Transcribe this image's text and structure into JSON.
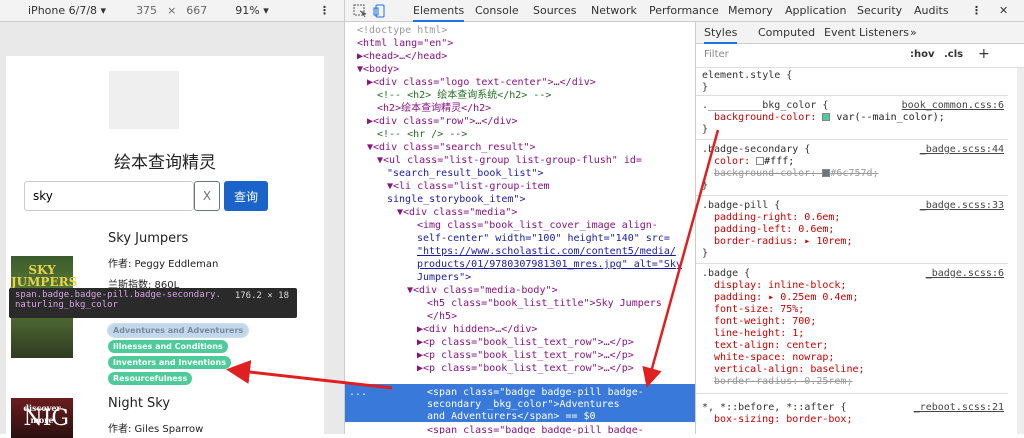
{
  "device_bar": {
    "device": "iPhone 6/7/8 ▾",
    "width": "375",
    "times": "×",
    "height": "667",
    "zoom": "91% ▾",
    "more": "⋮"
  },
  "page": {
    "title": "绘本查询精灵",
    "search_value": "sky",
    "clear_label": "X",
    "search_button": "查询",
    "books": [
      {
        "title": "Sky Jumpers",
        "author": "作者: Peggy Eddleman",
        "lexile": "兰斯指数: 860L",
        "cover_text": "SKY JUMPERS"
      },
      {
        "title": "Night Sky",
        "author": "作者: Giles Sparrow",
        "cover_text": "discover more",
        "cover_big": "NIG"
      }
    ],
    "badges": [
      "Adventures and Adventurers",
      "Illnesses and Conditions",
      "Inventors and Inventions",
      "Resourcefulness"
    ],
    "tooltip": {
      "selector": "span.badge.badge-pill.badge-secondary.",
      "selector2": "naturling_bkg_color",
      "dims": "176.2 × 18"
    }
  },
  "devtools": {
    "tabs": [
      "Elements",
      "Console",
      "Sources",
      "Network",
      "Performance",
      "Memory",
      "Application",
      "Security",
      "Audits"
    ],
    "active_tab": "Elements",
    "more": "⋮",
    "close": "✕",
    "elements": [
      "<!doctype html>",
      "<html lang=\"en\">",
      "▶<head>…</head>",
      "▼<body>",
      "▶<div class=\"logo text-center\">…</div>",
      "<!-- <h2>        绘本查询系统</h2> -->",
      "<h2>绘本查询精灵</h2>",
      "▶<div class=\"row\">…</div>",
      "<!-- <hr /> -->",
      "▼<div class=\"search_result\">",
      "▼<ul class=\"list-group list-group-flush\" id=",
      "\"search_result_book_list\">",
      "▼<li class=\"list-group-item",
      "single_storybook_item\">",
      "▼<div class=\"media\">",
      "<img class=\"book_list_cover_image align-",
      "self-center\" width=\"100\" height=\"140\" src=",
      "\"https://www.scholastic.com/content5/media/",
      "products/01/9780307981301_mres.jpg\" alt=\"Sky",
      "Jumpers\">",
      "▼<div class=\"media-body\">",
      "<h5 class=\"book_list_title\">Sky Jumpers",
      "</h5>",
      "▶<div hidden>…</div>",
      "▶<p class=\"book_list_text_row\">…</p>",
      "▶<p class=\"book_list_text_row\">…</p>",
      "▶<p class=\"book_list_text_row\">…</p>"
    ],
    "selected": [
      "<span class=\"badge badge-pill badge-",
      "secondary          _bkg_color\">Adventures",
      "and Adventurers</span> == $0"
    ],
    "last_line": "<span class=\"badge badge-pill badge-",
    "ellipsis": "...",
    "styles_tabs": [
      "Styles",
      "Computed",
      "Event Listeners",
      "»"
    ],
    "filter_placeholder": "Filter",
    "hov": ":hov",
    "cls": ".cls",
    "plus": "+",
    "rules": {
      "element_style": "element.style {",
      "close": "}",
      "r1_sel": "._________bkg_color {",
      "r1_src": "book_common.css:6",
      "r1_p": "background-color: ",
      "r1_v": "var(--main_color);",
      "r2_sel": ".badge-secondary {",
      "r2_src": "_badge.scss:44",
      "r2_p1": "color: ",
      "r2_v1": "#fff;",
      "r2_p2": "background-color: ",
      "r2_v2": "#6c757d;",
      "r3_sel": ".badge-pill {",
      "r3_src": "_badge.scss:33",
      "r3_l1": "padding-right: 0.6em;",
      "r3_l2": "padding-left: 0.6em;",
      "r3_l3": "border-radius: ▸ 10rem;",
      "r4_sel": ".badge {",
      "r4_src": "_badge.scss:6",
      "r4_lines": [
        "display: inline-block;",
        "padding: ▸ 0.25em 0.4em;",
        "font-size: 75%;",
        "font-weight: 700;",
        "line-height: 1;",
        "text-align: center;",
        "white-space: nowrap;",
        "vertical-align: baseline;"
      ],
      "r4_strike": "border-radius: 0.25rem;",
      "r5_sel": "*, *::before, *::after {",
      "r5_src": "_reboot.scss:21",
      "r5_l1": "box-sizing: border-box;"
    }
  },
  "colors": {
    "accent": "#1a73e8",
    "main_color": "#4ecb9a",
    "secondary": "#6c757d",
    "arrow": "#e02020"
  }
}
